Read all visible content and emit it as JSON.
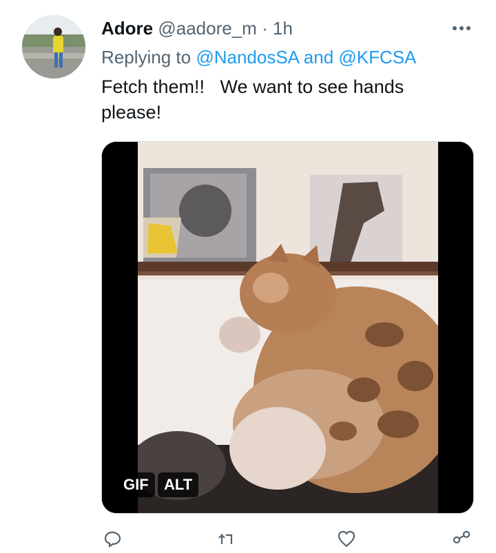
{
  "tweet": {
    "display_name": "Adore",
    "handle": "@aadore_m",
    "separator": "·",
    "time": "1h",
    "replying_prefix": "Replying to ",
    "mention_1": "@NandosSA",
    "mention_joiner": " and ",
    "mention_2": "@KFCSA",
    "text": "Fetch them!!   We want to see hands\nplease!",
    "media": {
      "gif_badge": "GIF",
      "alt_badge": "ALT"
    }
  },
  "icons": {
    "more": "more-horizontal-icon",
    "reply": "reply-icon",
    "retweet": "retweet-icon",
    "like": "heart-icon",
    "share": "share-icon"
  },
  "colors": {
    "text": "#0f1419",
    "secondary": "#536471",
    "link": "#1d9bf0"
  }
}
